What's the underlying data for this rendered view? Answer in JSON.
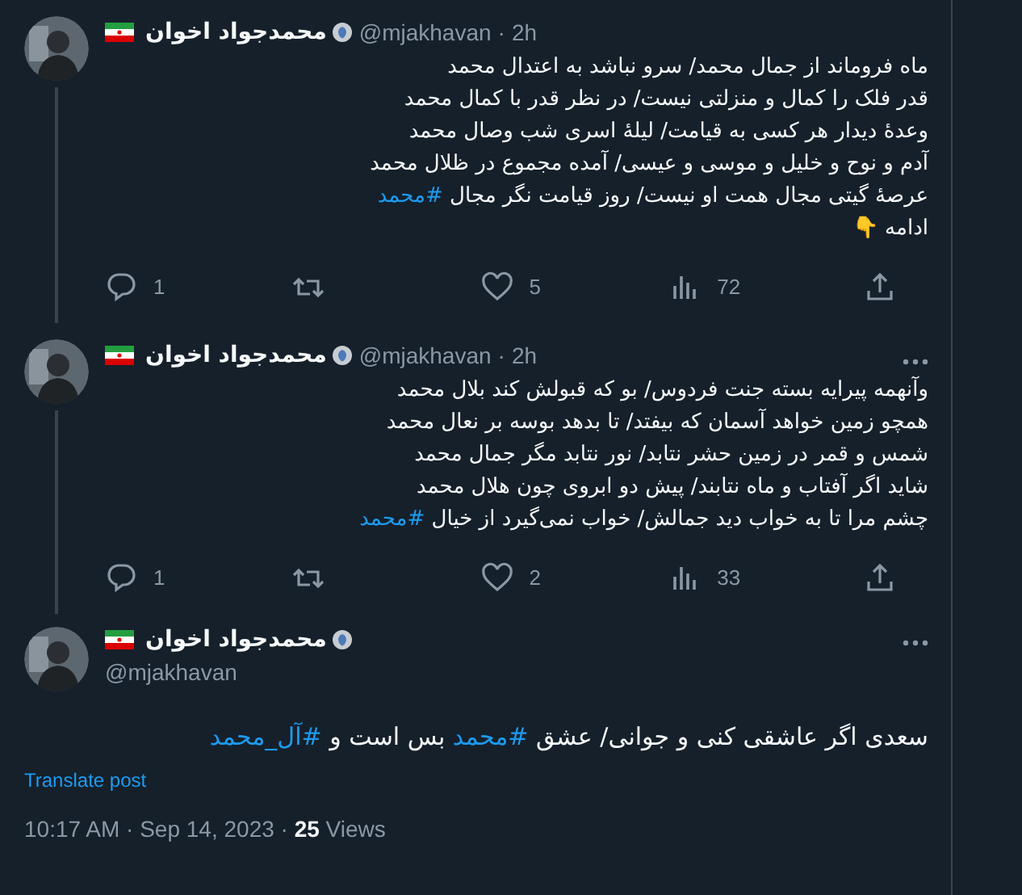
{
  "tweets": [
    {
      "name": "محمدجواد اخوان",
      "handle": "@mjakhavan",
      "separator": "·",
      "time": "2h",
      "more": false,
      "lines": [
        [
          {
            "kind": "plain",
            "text": "ماه فروماند از جمال محمد/ سرو نباشد به اعتدال محمد"
          }
        ],
        [
          {
            "kind": "plain",
            "text": "قدر فلک را کمال و منزلتی نیست/ در نظر قدر با کمال محمد"
          }
        ],
        [
          {
            "kind": "plain",
            "text": "وعدهٔ دیدار هر کسی به قیامت/ لیلهٔ اسری شب وصال محمد"
          }
        ],
        [
          {
            "kind": "plain",
            "text": "آدم و نوح و خلیل و موسی و عیسی/ آمده مجموع در ظلال محمد"
          }
        ],
        [
          {
            "kind": "plain",
            "text": "عرصهٔ گیتی مجال همت او نیست/ روز قیامت نگر مجال "
          },
          {
            "kind": "hashtag",
            "text": "#محمد"
          }
        ],
        [
          {
            "kind": "plain",
            "text": "ادامه 👇"
          }
        ]
      ],
      "actions": {
        "replies": "1",
        "likes": "5",
        "views": "72"
      }
    },
    {
      "name": "محمدجواد اخوان",
      "handle": "@mjakhavan",
      "separator": "·",
      "time": "2h",
      "more": true,
      "lines": [
        [
          {
            "kind": "plain",
            "text": "وآنهمه پیرایه بسته جنت فردوس/ بو که قبولش کند بلال محمد"
          }
        ],
        [
          {
            "kind": "plain",
            "text": "همچو زمین خواهد آسمان که بیفتد/ تا بدهد بوسه بر نعال محمد"
          }
        ],
        [
          {
            "kind": "plain",
            "text": "شمس و قمر در زمین حشر نتابد/ نور نتابد مگر جمال محمد"
          }
        ],
        [
          {
            "kind": "plain",
            "text": "شاید اگر آفتاب و ماه نتابند/ پیش دو ابروی چون هلال محمد"
          }
        ],
        [
          {
            "kind": "plain",
            "text": "چشم مرا تا به خواب دید جمالش/ خواب نمی‌گیرد از خیال "
          },
          {
            "kind": "hashtag",
            "text": "#محمد"
          }
        ]
      ],
      "actions": {
        "replies": "1",
        "likes": "2",
        "views": "33"
      }
    }
  ],
  "main_tweet": {
    "name": "محمدجواد اخوان",
    "handle": "@mjakhavan",
    "more": true,
    "lines": [
      [
        {
          "kind": "plain",
          "text": "سعدی اگر عاشقی کنی و جوانی/ عشق "
        },
        {
          "kind": "hashtag",
          "text": "#محمد"
        },
        {
          "kind": "plain",
          "text": " بس است و "
        },
        {
          "kind": "hashtag",
          "text": "#آل_محمد"
        }
      ]
    ],
    "translate": "Translate post",
    "timestamp": "10:17 AM · Sep 14, 2023 · ",
    "views_count": "25",
    "views_label": " Views"
  }
}
